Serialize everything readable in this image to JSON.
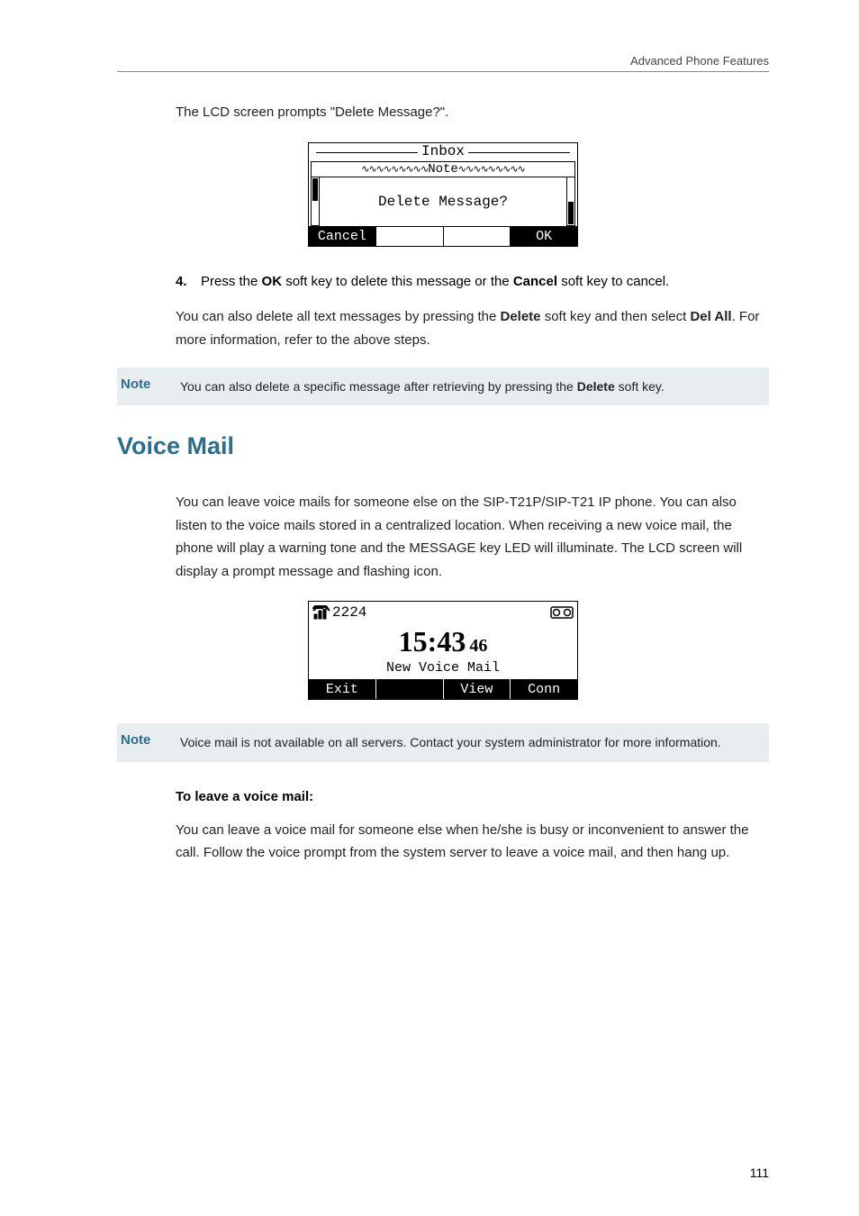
{
  "header": {
    "section": "Advanced Phone Features"
  },
  "intro1": "The LCD screen prompts \"Delete Message?\".",
  "lcd1": {
    "title": "Inbox",
    "note": "Note",
    "msg": "Delete Message?",
    "sk1": "Cancel",
    "sk4": "OK"
  },
  "step4": {
    "num": "4.",
    "pre": "Press the ",
    "ok": "OK",
    "mid1": " soft key to delete this message or the ",
    "cancel": "Cancel",
    "post": " soft key to cancel."
  },
  "para2a": "You can also delete all text messages by pressing the ",
  "deltxt": "Delete",
  "para2b": " soft key and then select ",
  "delall": "Del All",
  "para2c": ". For more information, refer to the above steps.",
  "note1": {
    "label": "Note",
    "t1": "You can also delete a specific message after retrieving by pressing the ",
    "b": "Delete",
    "t2": " soft key."
  },
  "voicemail": {
    "heading": "Voice Mail",
    "p": "You can leave voice mails for someone else on the SIP-T21P/SIP-T21 IP phone. You can also listen to the voice mails stored in a centralized location. When receiving a new voice mail, the phone will play a warning tone and the MESSAGE key LED will illuminate. The LCD screen will display a prompt message and flashing icon."
  },
  "lcd2": {
    "ext": "2224",
    "time": "15:43",
    "sec": "46",
    "line": "New Voice Mail",
    "sk1": "Exit",
    "sk3": "View",
    "sk4": "Conn"
  },
  "note2": {
    "label": "Note",
    "text": "Voice mail is not available on all servers. Contact your system administrator for more information."
  },
  "leave": {
    "heading": "To leave a voice mail:",
    "p": "You can leave a voice mail for someone else when he/she is busy or inconvenient to answer the call. Follow the voice prompt from the system server to leave a voice mail, and then hang up."
  },
  "pagenum": "111"
}
